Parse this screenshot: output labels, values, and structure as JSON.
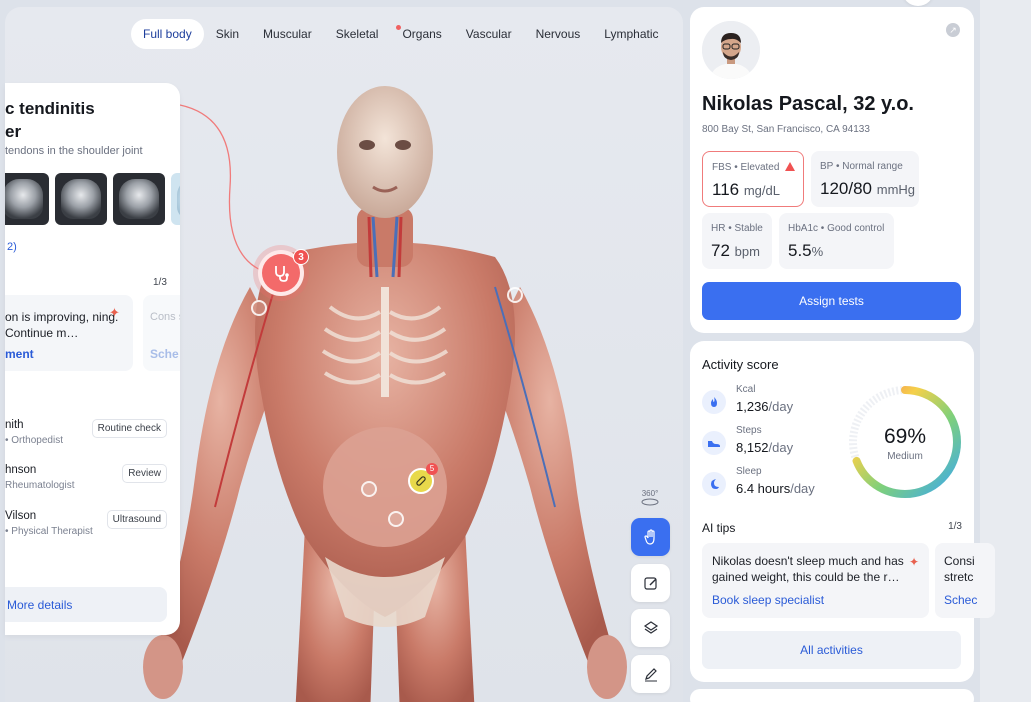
{
  "tabs": [
    {
      "label": "Full body",
      "active": true
    },
    {
      "label": "Skin"
    },
    {
      "label": "Muscular"
    },
    {
      "label": "Skeletal"
    },
    {
      "label": "Organs",
      "dot": true
    },
    {
      "label": "Vascular"
    },
    {
      "label": "Nervous"
    },
    {
      "label": "Lymphatic"
    }
  ],
  "condition": {
    "title_line1": "c tendinitis",
    "title_line2": "er",
    "subtitle": "tendons in the shoulder joint",
    "images_link": "2)",
    "tips_count": "1/3",
    "tip_text": "on is improving, ning. Continue m…",
    "tip_link": "ment",
    "tip2_text": "Cons strete",
    "tip2_link": "Sche",
    "doctors": [
      {
        "name": "nith",
        "role": "• Orthopedist",
        "badge": "Routine check"
      },
      {
        "name": "hnson",
        "role": "Rheumatologist",
        "badge": "Review"
      },
      {
        "name": "Vilson",
        "role": "• Physical Therapist",
        "badge": "Ultrasound"
      }
    ],
    "more_details": "More details"
  },
  "markers": {
    "heart_count": "3",
    "gut_count": "5"
  },
  "toolbar": {
    "rotate_label": "360°",
    "tools": [
      {
        "name": "hand-tool",
        "icon": "hand-icon",
        "active": true
      },
      {
        "name": "edit-tool",
        "icon": "edit-icon"
      },
      {
        "name": "layers-tool",
        "icon": "layers-icon"
      },
      {
        "name": "draw-tool",
        "icon": "pen-icon"
      }
    ]
  },
  "patient": {
    "name": "Nikolas Pascal, 32 y.o.",
    "address": "800 Bay St, San Francisco, CA 94133",
    "metrics": [
      {
        "label": "FBS • Elevated",
        "value": "116",
        "unit": "mg/dL",
        "alert": true
      },
      {
        "label": "BP • Normal range",
        "value": "120/80",
        "unit": "mmHg"
      },
      {
        "label": "HR • Stable",
        "value": "72",
        "unit": "bpm"
      },
      {
        "label": "HbA1c • Good control",
        "value": "5.5",
        "unit": "%"
      }
    ],
    "assign_button": "Assign tests"
  },
  "activity": {
    "title": "Activity score",
    "items": [
      {
        "label": "Kcal",
        "value": "1,236",
        "unit": "/day",
        "icon": "flame-icon"
      },
      {
        "label": "Steps",
        "value": "8,152",
        "unit": "/day",
        "icon": "shoe-icon"
      },
      {
        "label": "Sleep",
        "value": "6.4 hours",
        "unit": "/day",
        "icon": "moon-icon"
      }
    ],
    "score": 69,
    "score_label": "69%",
    "score_desc": "Medium",
    "ai_title": "AI tips",
    "ai_count": "1/3",
    "ai_tip": "Nikolas doesn't sleep much and has gained weight, this could be the r…",
    "ai_link": "Book sleep specialist",
    "ai_tip2": "Consi stretc",
    "ai_link2": "Schec",
    "all_button": "All activities"
  },
  "colors": {
    "accent": "#3a6ff0",
    "alert": "#f05252",
    "link": "#2a5bd7"
  }
}
